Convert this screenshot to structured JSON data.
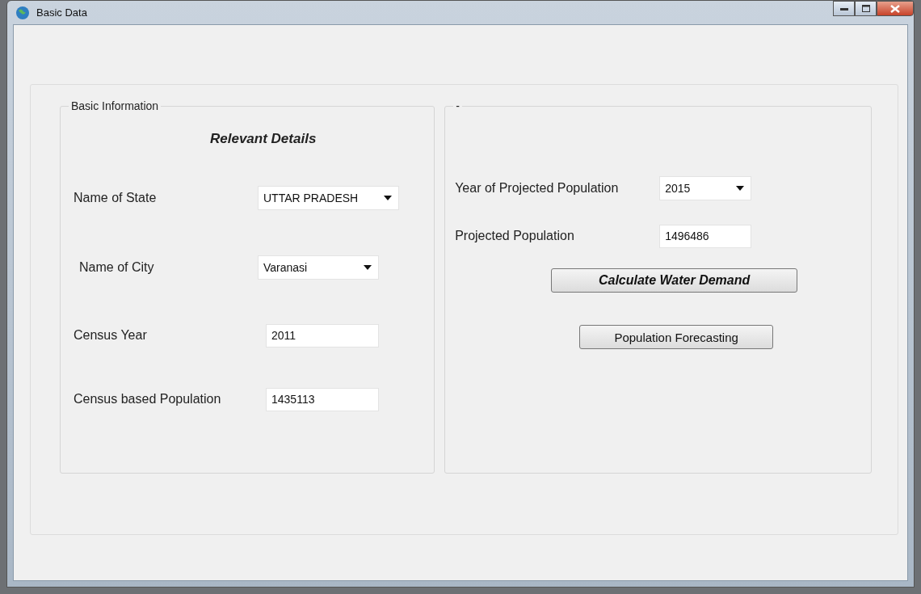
{
  "window": {
    "title": "Basic Data"
  },
  "left_group": {
    "title": "Basic Information",
    "heading": "Relevant Details",
    "fields": [
      {
        "kind": "dropdown",
        "label": "Name of State",
        "value": "UTTAR PRADESH"
      },
      {
        "kind": "dropdown",
        "label": "Name of City",
        "value": "Varanasi"
      },
      {
        "kind": "text",
        "label": "Census Year",
        "value": "2011"
      },
      {
        "kind": "text",
        "label": "Census based Population",
        "value": "1435113"
      }
    ]
  },
  "right_group": {
    "title": "-",
    "fields": [
      {
        "kind": "dropdown",
        "label": "Year of Projected Population",
        "value": "2015"
      },
      {
        "kind": "text",
        "label": "Projected Population",
        "value": "1496486"
      }
    ],
    "buttons": [
      {
        "label": "Calculate Water Demand",
        "emphasis": true
      },
      {
        "label": "Population Forecasting",
        "emphasis": false
      }
    ]
  }
}
